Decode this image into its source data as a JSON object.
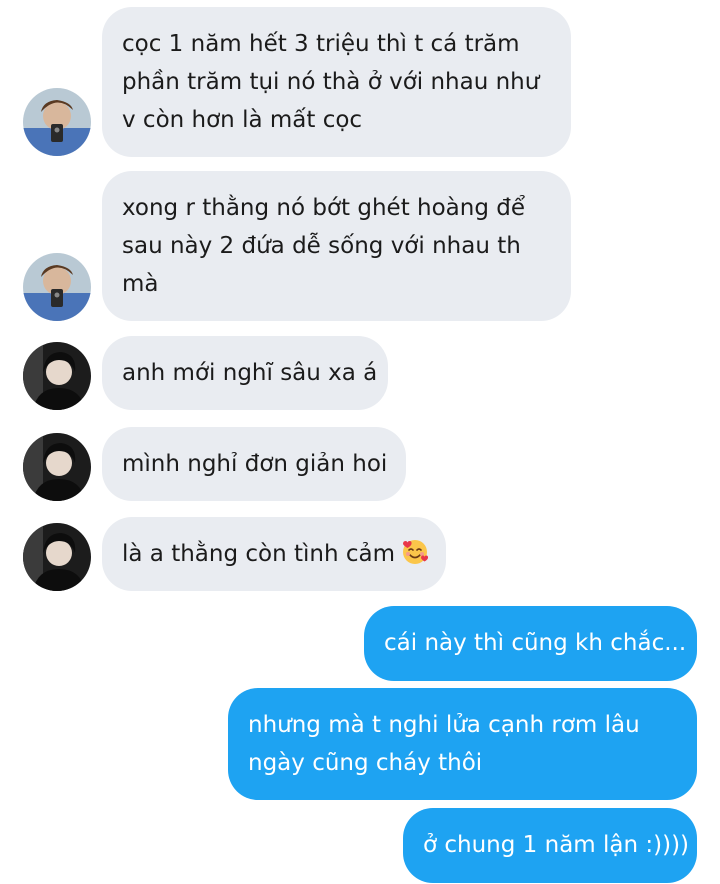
{
  "colors": {
    "incoming_bubble": "#e9ecf1",
    "outgoing_bubble": "#1ea3f2",
    "incoming_text": "#1b1b1b",
    "outgoing_text": "#ffffff"
  },
  "messages": [
    {
      "direction": "incoming",
      "sender_avatar": "avatar-a",
      "lines": [
        "cọc 1 năm hết 3 triệu thì t cá trăm",
        "phần trăm tụi nó thà ở với nhau như",
        "v còn hơn là mất cọc"
      ]
    },
    {
      "direction": "incoming",
      "sender_avatar": "avatar-a",
      "lines": [
        "xong r thằng nó bớt ghét hoàng để",
        "sau này 2 đứa dễ sống với nhau th",
        "mà"
      ]
    },
    {
      "direction": "incoming",
      "sender_avatar": "avatar-b",
      "lines": [
        "anh mới nghĩ sâu xa á"
      ]
    },
    {
      "direction": "incoming",
      "sender_avatar": "avatar-b",
      "lines": [
        "mình nghỉ đơn giản hoi"
      ]
    },
    {
      "direction": "incoming",
      "sender_avatar": "avatar-b",
      "lines": [
        "là a thằng còn tình cảm"
      ],
      "emoji": "smiling-face-with-hearts-emoji"
    },
    {
      "direction": "outgoing",
      "lines": [
        "cái này thì cũng kh chắc..."
      ]
    },
    {
      "direction": "outgoing",
      "lines": [
        "nhưng mà t nghi lửa cạnh rơm lâu",
        "ngày cũng cháy thôi"
      ]
    },
    {
      "direction": "outgoing",
      "lines": [
        "ở chung 1 năm lận :))))"
      ]
    }
  ]
}
